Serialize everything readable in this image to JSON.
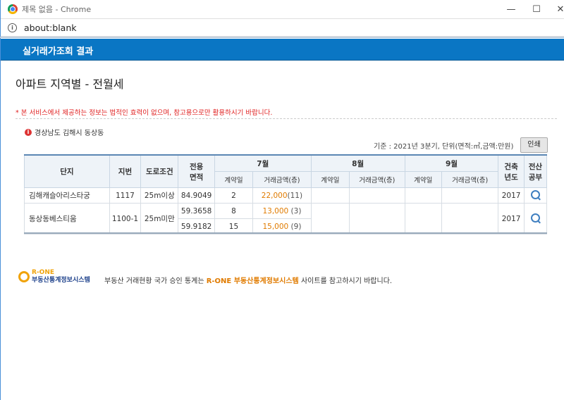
{
  "window": {
    "title": "제목 없음 - Chrome",
    "url": "about:blank",
    "min": "—",
    "max": "☐",
    "close": "✕"
  },
  "header": {
    "title": "실거래가조회 결과"
  },
  "page": {
    "title": "아파트 지역별 - 전월세",
    "notice": "* 본 서비스에서 제공하는 정보는 법적인 효력이 없으며, 참고용으로만 활용하시기 바랍니다.",
    "region": "경상남도 김해시 동상동",
    "basis": "기준 : 2021년 3분기, 단위(면적:㎡,금액:만원)",
    "print_label": "인쇄"
  },
  "table": {
    "headers": {
      "complex": "단지",
      "lot": "지번",
      "road": "도로조건",
      "area_1": "전용",
      "area_2": "면적",
      "built_1": "건축",
      "built_2": "년도",
      "reg_1": "전산",
      "reg_2": "공부"
    },
    "months": [
      "7월",
      "8월",
      "9월"
    ],
    "sub_headers": {
      "date": "계약일",
      "amount": "거래금액(층)"
    },
    "rows": [
      {
        "name": "김해캐슬아리스타궁",
        "lot": "1117",
        "road": "25m이상",
        "area": "84.9049",
        "d7": "2",
        "a7": "22,000",
        "f7": "(11)",
        "year": "2017"
      },
      {
        "name": "동상동베스티움",
        "lot": "1100-1",
        "road": "25m미만",
        "area": "59.3658",
        "d7": "8",
        "a7": "13,000",
        "f7": "(3)",
        "year": "2017"
      },
      {
        "area": "59.9182",
        "d7": "15",
        "a7": "15,000",
        "f7": "(9)"
      }
    ]
  },
  "footer": {
    "logo_top": "R-ONE",
    "logo_bottom": "부동산통계정보시스템",
    "text_pre": "부동산 거래현황 국가 승인 통계는",
    "text_hl": "R-ONE 부동산통계정보시스템",
    "text_post": "사이트를 참고하시기 바랍니다."
  }
}
